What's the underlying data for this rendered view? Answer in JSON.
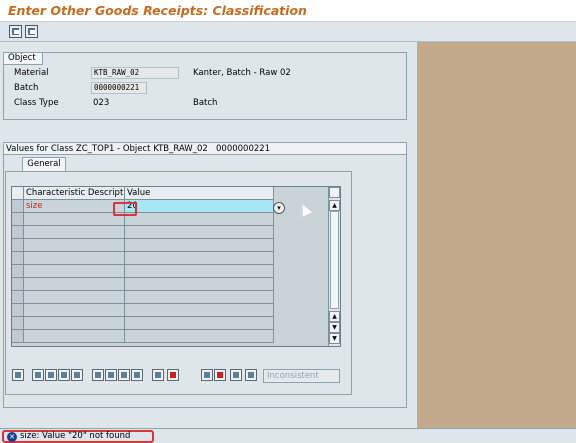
{
  "window": {
    "title": "Enter Other Goods Receipts: Classification"
  },
  "object_group": {
    "title": "Object",
    "material_label": "Material",
    "material_value": "KTB_RAW_02",
    "material_desc": "Kanter, Batch - Raw 02",
    "batch_label": "Batch",
    "batch_value": "0000000221",
    "class_type_label": "Class Type",
    "class_type_value": "023",
    "class_type_desc": "Batch"
  },
  "values_group": {
    "title": "Values for Class ZC_TOP1 - Object KTB_RAW_02",
    "object_id": "0000000221",
    "tab": "General",
    "columns": [
      "Characteristic Description",
      "Value"
    ],
    "rows": [
      {
        "description": "size",
        "value": "20"
      }
    ],
    "inconsistent_label": "Inconsistent"
  },
  "status": {
    "text": "size: Value \"20\" not found",
    "type": "error",
    "colors": {
      "error": "#1a3f8f",
      "highlight": "#d8343c"
    }
  },
  "icons": {
    "toolbar": [
      "save-icon",
      "save-as-icon"
    ],
    "table_tools": [
      "details-icon",
      "select-all-icon",
      "deselect-all-icon",
      "sort-asc-icon",
      "sort-desc-icon",
      "cut-icon",
      "copy-icon",
      "paste-icon",
      "delete-icon",
      "insert-icon",
      "info-icon",
      "find-icon",
      "filter-icon",
      "settings-icon",
      "warning-icon"
    ]
  }
}
